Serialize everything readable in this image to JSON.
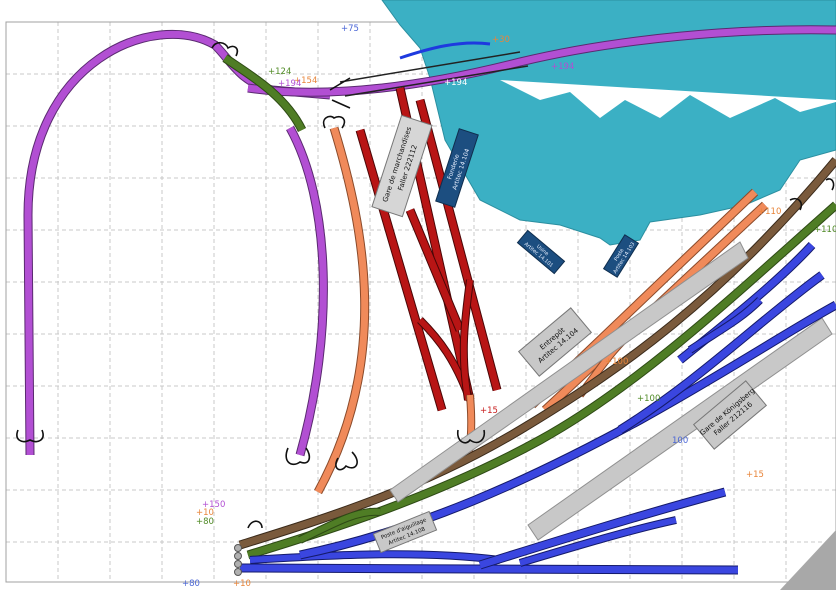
{
  "colors": {
    "water": "#3bb0c4",
    "purple": "#b24fd3",
    "salmon": "#f08a5a",
    "red": "#b81515",
    "green": "#4f7d25",
    "brown": "#7a5a3c",
    "blue": "#3a46e0",
    "platform": "#c8c8c8",
    "grid": "#c9c9c9",
    "navy_box": "#1c4e80"
  },
  "height_labels": {
    "h75": "+75",
    "h30": "+30",
    "h124": "+124",
    "h154": "+154",
    "h194a": "+194",
    "h194b": "+194",
    "h194c": "+194",
    "h110a": "+110",
    "h110b": "+110",
    "h100a": "+100",
    "h100b": "+100",
    "h100c": "100",
    "h15a": "+15",
    "h15b": "+15",
    "h150": "+150",
    "h10a": "+10",
    "h80a": "+80",
    "h80b": "+80",
    "h10b": "+10"
  },
  "boxes": {
    "gare_marchandises": [
      "Gare de marchandises",
      "Faller 222112"
    ],
    "fonderie": [
      "Fonderie",
      "Artitec 14.104"
    ],
    "usine": [
      "Usine",
      "Artitec 14.101"
    ],
    "entrepot": [
      "Entrepôt",
      "Artitec 14.104"
    ],
    "poste": [
      "Poste",
      "Artitec 14.103"
    ],
    "gare_konigsberg": [
      "Gare de Königsberg",
      "Faller 212116"
    ],
    "poste_aiguillage": [
      "Poste d'aiguillage",
      "Artitec 14.108"
    ]
  }
}
